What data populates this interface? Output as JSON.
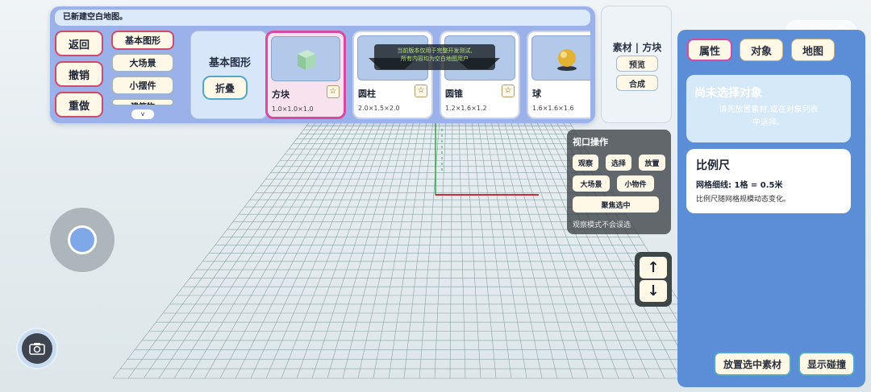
{
  "status": {
    "message": "已新建空白地图。"
  },
  "left_buttons": [
    "返回",
    "撤销",
    "重做"
  ],
  "categories": [
    "基本图形",
    "大场景",
    "小摆件",
    "建筑物"
  ],
  "category_more": "v",
  "category_box": {
    "title": "基本图形",
    "fold_label": "折叠"
  },
  "assets": [
    {
      "name": "方块",
      "size": "1.0×1.0×1.0",
      "icon": "cube-icon",
      "selected": true
    },
    {
      "name": "圆柱",
      "size": "2.0×1.5×2.0",
      "icon": "cylinder-icon",
      "selected": false
    },
    {
      "name": "圆锥",
      "size": "1.2×1.6×1.2",
      "icon": "cone-icon",
      "selected": false
    },
    {
      "name": "球",
      "size": "1.6×1.6×1.6",
      "icon": "sphere-icon",
      "selected": false
    }
  ],
  "star_glyph": "☆",
  "tooltip": {
    "line1": "当前版本仅用于完整开发测试,",
    "line2": "所有内容均为空白地图用户"
  },
  "material_panel": {
    "title": "素材 | 方块",
    "preview_label": "预览",
    "compose_label": "合成"
  },
  "properties": {
    "tabs": [
      "属性",
      "对象",
      "地图"
    ],
    "active_tab": "属性",
    "empty_title": "尚未选择对象",
    "empty_hint_1": "请先放置素材,或在对象列表",
    "empty_hint_2": "中选择。",
    "scale_title": "比例尺",
    "scale_line": "网格细线: 1格 = 0.5米",
    "scale_note": "比例尺随网格规模动态变化。",
    "place_button": "放置选中素材",
    "collision_button": "显示碰撞"
  },
  "viewport_ops": {
    "title": "视口操作",
    "buttons_row1": [
      "观察",
      "选择",
      "放置"
    ],
    "buttons_row2": [
      "大场景",
      "小物件"
    ],
    "focus_button": "聚焦选中",
    "note": "观察模式不会误选"
  },
  "arrows": {
    "up": "↑",
    "down": "↓"
  },
  "colors": {
    "panel_blue": "#9bb1ea",
    "props_blue": "#5b8ed6",
    "selected_pink": "#d84aa0",
    "axis_red": "#cc2a3a",
    "axis_green": "#2ca84a",
    "grid_line": "#7f9a9a"
  }
}
